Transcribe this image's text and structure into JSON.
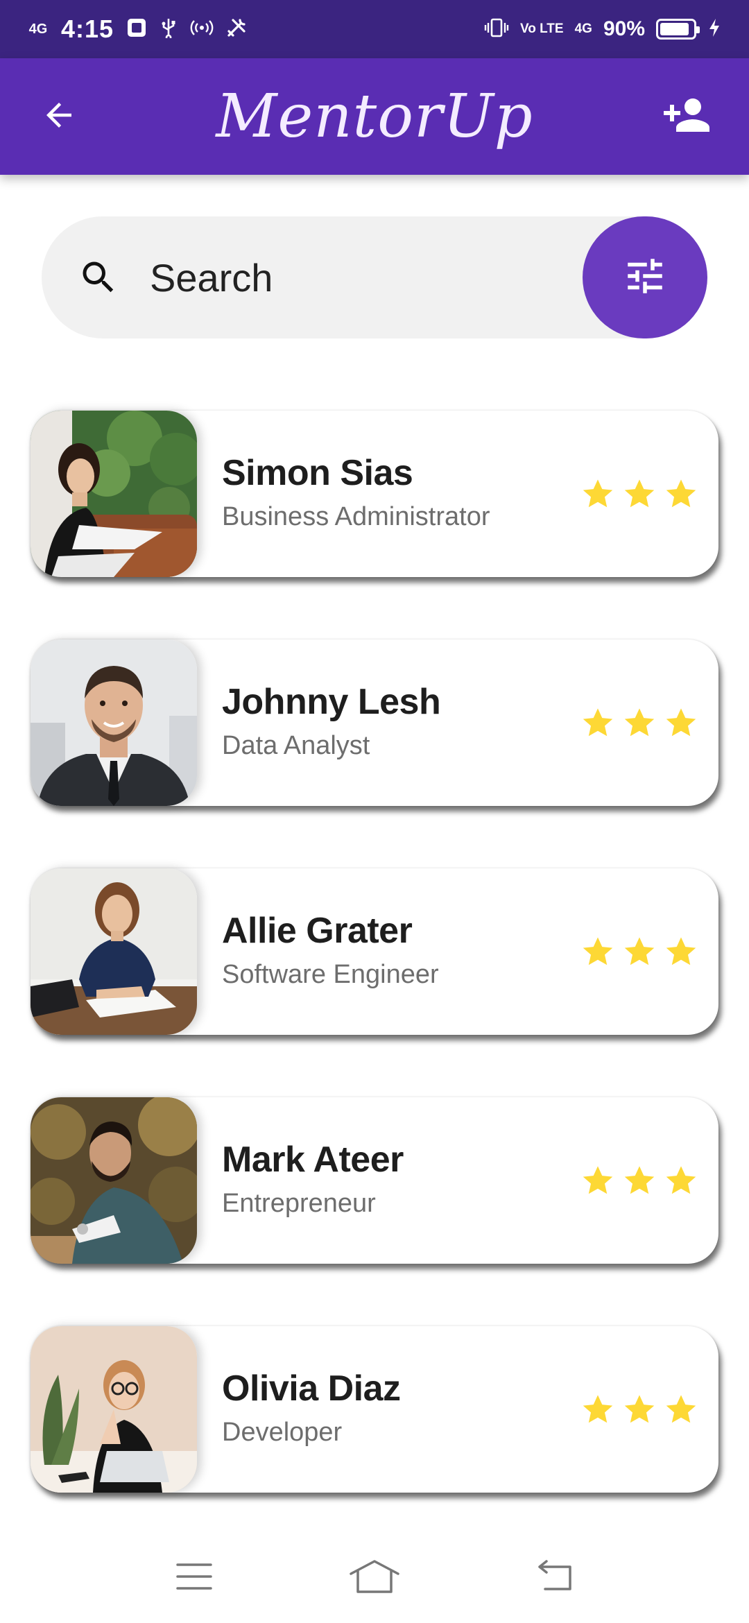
{
  "status_bar": {
    "network_left": "4G",
    "time": "4:15",
    "volte": "Vo LTE",
    "network_right": "4G",
    "battery_percent": "90%",
    "battery_level": 0.9
  },
  "app_bar": {
    "title": "MentorUp",
    "back_icon": "arrow-back-icon",
    "add_icon": "person-add-icon"
  },
  "search": {
    "placeholder": "Search",
    "icon": "search-icon",
    "filter_icon": "tune-icon"
  },
  "mentors": [
    {
      "name": "Simon Sias",
      "role": "Business Administrator",
      "stars": 3
    },
    {
      "name": "Johnny Lesh",
      "role": "Data Analyst",
      "stars": 3
    },
    {
      "name": "Allie Grater",
      "role": "Software Engineer",
      "stars": 3
    },
    {
      "name": "Mark Ateer",
      "role": "Entrepreneur",
      "stars": 3
    },
    {
      "name": "Olivia Diaz",
      "role": "Developer",
      "stars": 3
    }
  ],
  "nav_bar": {
    "menu_icon": "menu-icon",
    "home_icon": "home-icon",
    "back_icon": "back-icon"
  },
  "colors": {
    "status_bar": "#3b2480",
    "app_bar": "#5a2db3",
    "accent": "#6a3bbf",
    "star": "#fdd835"
  }
}
